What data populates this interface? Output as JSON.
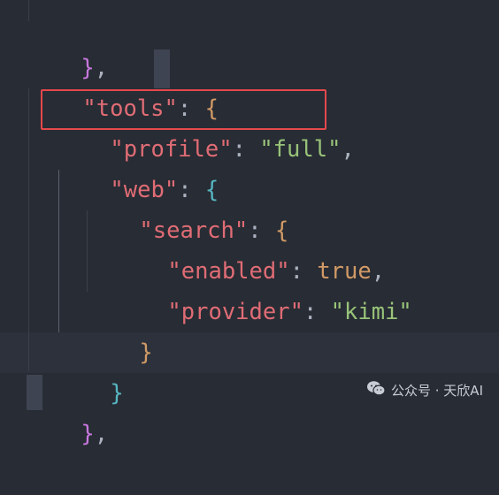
{
  "code": {
    "line1": {
      "close": "}",
      "comma": ","
    },
    "line2": {
      "key": "\"tools\"",
      "colon": ": ",
      "open": "{"
    },
    "line3": {
      "key": "\"profile\"",
      "colon": ": ",
      "value": "\"full\"",
      "comma": ","
    },
    "line4": {
      "key": "\"web\"",
      "colon": ": ",
      "open": "{"
    },
    "line5": {
      "key": "\"search\"",
      "colon": ": ",
      "open": "{"
    },
    "line6": {
      "key": "\"enabled\"",
      "colon": ": ",
      "value": "true",
      "comma": ","
    },
    "line7": {
      "key": "\"provider\"",
      "colon": ": ",
      "value": "\"kimi\""
    },
    "line8": {
      "close": "}"
    },
    "line9": {
      "close": "}"
    },
    "line10": {
      "close": "}",
      "comma": ","
    }
  },
  "watermark": {
    "icon": "wechat-icon",
    "text": "公众号 · 天欣AI"
  },
  "colors": {
    "background": "#282c34",
    "key": "#e06c75",
    "string": "#98c379",
    "boolean": "#d19a66",
    "highlight_box": "#e5484d"
  }
}
